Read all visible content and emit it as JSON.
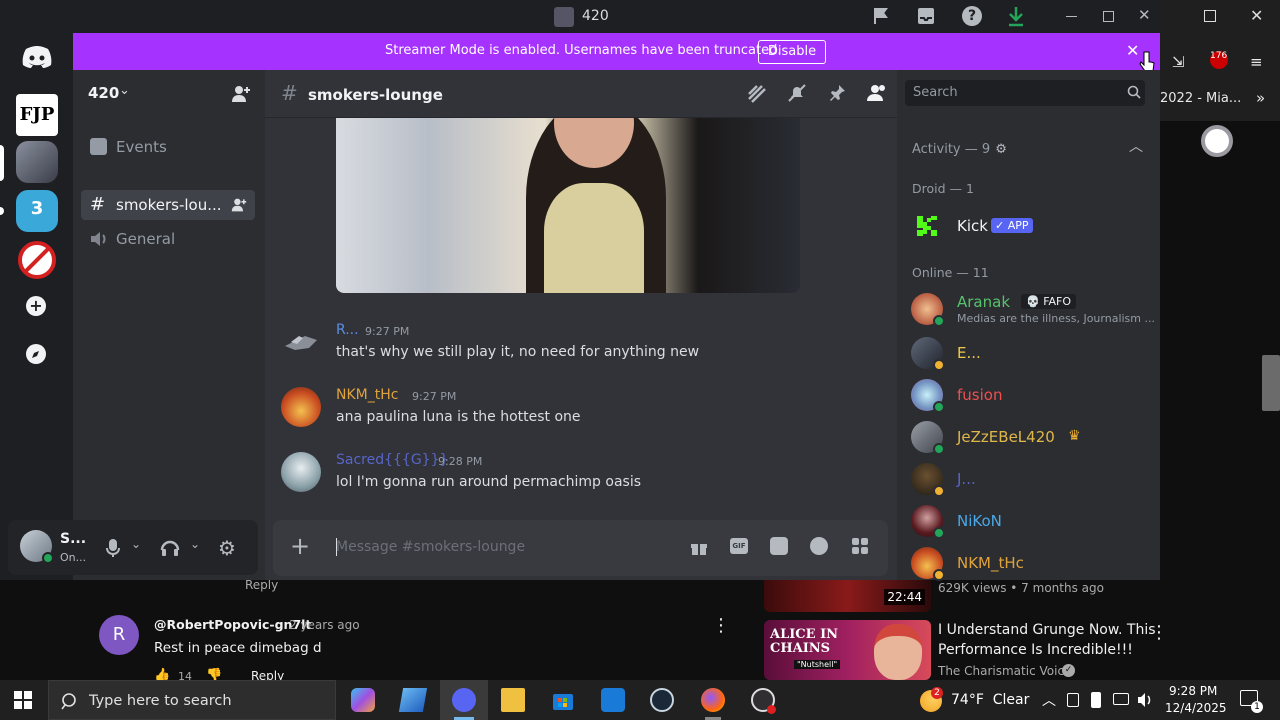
{
  "titlebar": {
    "title": "420"
  },
  "streamer": {
    "message": "Streamer Mode is enabled. Usernames have been truncated.",
    "disable_label": "Disable"
  },
  "guild": {
    "name": "420"
  },
  "channels": {
    "events_label": "Events",
    "items": [
      {
        "name": "smokers-lou...",
        "type": "text",
        "selected": true
      },
      {
        "name": "General",
        "type": "voice",
        "selected": false
      }
    ]
  },
  "user_panel": {
    "name": "S...",
    "status": "On..."
  },
  "chat": {
    "channel_name": "smokers-lounge",
    "messages": [
      {
        "author": "R...",
        "time": "9:27 PM",
        "text": "that's why we still play it, no need for anything new",
        "color": "#5a8ee6"
      },
      {
        "author": "NKM_tHc",
        "time": "9:27 PM",
        "text": "ana paulina luna is the hottest one",
        "color": "#e0a23a"
      },
      {
        "author": "Sacred{{{G}}}",
        "time": "9:28 PM",
        "text": "lol I'm gonna run around permachimp oasis",
        "color": "#5865c8"
      }
    ],
    "composer_placeholder": "Message #smokers-lounge"
  },
  "members": {
    "search_placeholder": "Search",
    "activity_header": "Activity — 9",
    "droid_header": "Droid — 1",
    "droid": {
      "name": "Kick",
      "badge": "✓ APP"
    },
    "online_header": "Online — 11",
    "online": [
      {
        "name": "Aranak",
        "tag": "💀 FAFO",
        "sub": "Medias are the illness, Journalism ...",
        "color": "#57c26d"
      },
      {
        "name": "E...",
        "color": "#f0c84a"
      },
      {
        "name": "fusion",
        "color": "#f24e4e"
      },
      {
        "name": "JeZzEBeL420",
        "crown": "♛",
        "color": "#e0b84a"
      },
      {
        "name": "J...",
        "color": "#5865c8"
      },
      {
        "name": "NiKoN",
        "color": "#4aa8e8"
      },
      {
        "name": "NKM_tHc",
        "color": "#e0a23a"
      }
    ]
  },
  "background": {
    "browser_tab_text": "2022 - Mia...",
    "notif_count": "176",
    "comment": {
      "avatar_letter": "R",
      "author": "@RobertPopovic-gn7lt",
      "age": "2 years ago",
      "text": "Rest in peace dimebag d",
      "likes": "14",
      "reply": "Reply",
      "prev_reply": "Reply"
    },
    "video1": {
      "duration": "22:44",
      "meta": "629K views • 7 months ago"
    },
    "video2": {
      "thumb_text": "ALICE IN CHAINS",
      "thumb_sub": "\"Nutshell\"",
      "title_line1": "I Understand Grunge Now. This",
      "title_line2": "Performance Is Incredible!!!",
      "channel": "The Charismatic Voice"
    }
  },
  "taskbar": {
    "search_placeholder": "Type here to search",
    "weather": "74°F  Clear",
    "time": "9:28 PM",
    "date": "12/4/2025",
    "notif_badge": "1",
    "weather_badge": "2"
  }
}
